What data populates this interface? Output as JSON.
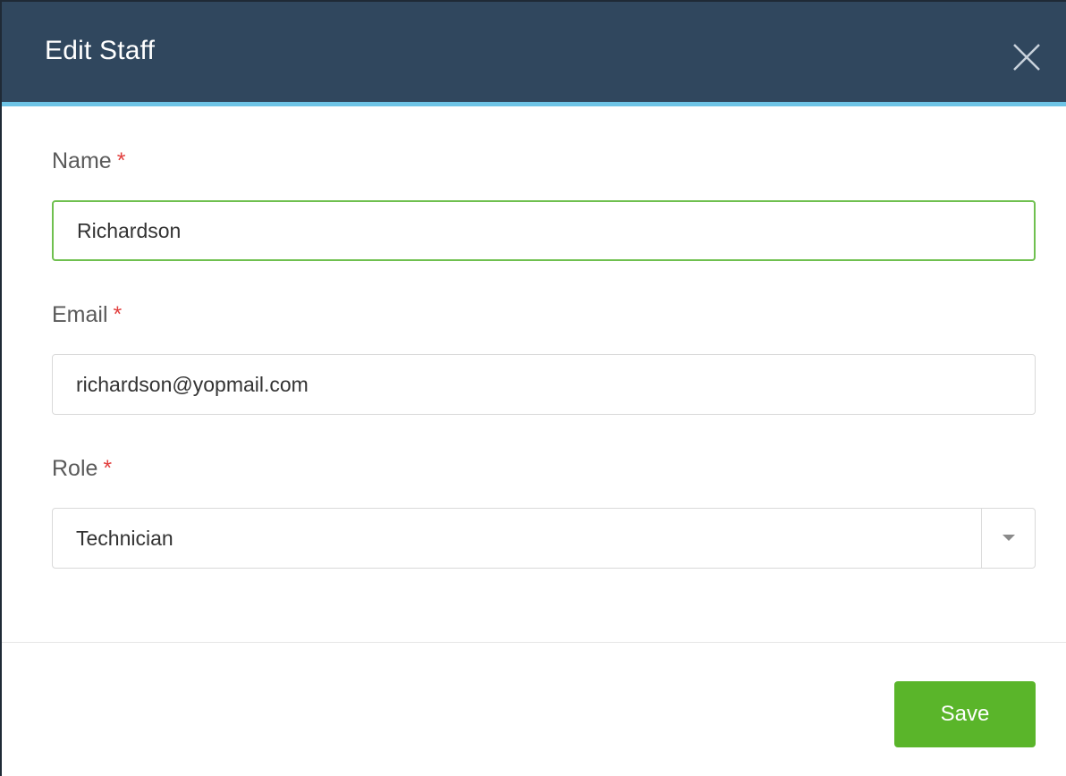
{
  "modal": {
    "title": "Edit Staff",
    "close_icon": "close-icon"
  },
  "colors": {
    "header_bg": "#30475e",
    "header_accent": "#6ec4e6",
    "required_star": "#e2403f",
    "focus_border": "#6fc04f",
    "save_button": "#5ab52a"
  },
  "form": {
    "name": {
      "label": "Name",
      "required_mark": "*",
      "value": "Richardson"
    },
    "email": {
      "label": "Email",
      "required_mark": "*",
      "value": "richardson@yopmail.com"
    },
    "role": {
      "label": "Role",
      "required_mark": "*",
      "selected": "Technician",
      "dropdown_icon": "caret-down-icon"
    }
  },
  "footer": {
    "save_label": "Save"
  }
}
